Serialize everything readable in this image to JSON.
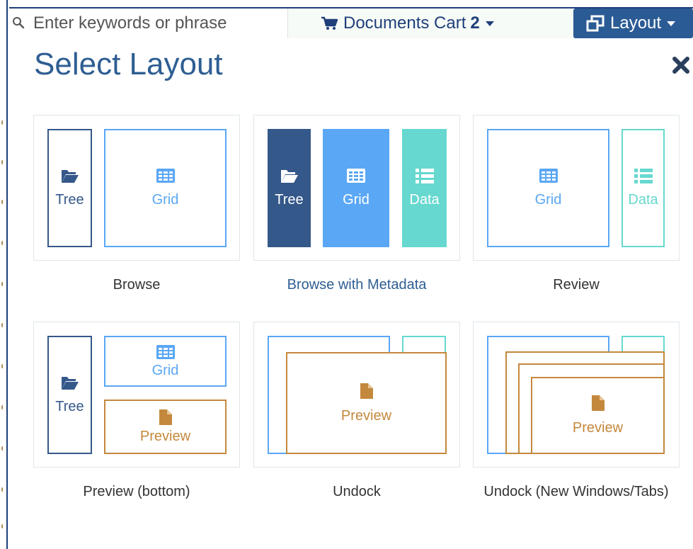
{
  "search": {
    "placeholder": "Enter keywords or phrase"
  },
  "cart": {
    "label": "Documents Cart",
    "count": "2"
  },
  "layout_button": {
    "label": "Layout"
  },
  "dialog": {
    "title": "Select Layout"
  },
  "pane_labels": {
    "tree": "Tree",
    "grid": "Grid",
    "data": "Data",
    "preview": "Preview"
  },
  "layouts": [
    {
      "caption": "Browse"
    },
    {
      "caption": "Browse with Metadata",
      "selected": true
    },
    {
      "caption": "Review"
    },
    {
      "caption": "Preview (bottom)"
    },
    {
      "caption": "Undock"
    },
    {
      "caption": "Undock (New Windows/Tabs)"
    }
  ],
  "colors": {
    "primary": "#2e5e92",
    "tree": "#35588a",
    "grid": "#5aa7f5",
    "data": "#66d8cf",
    "preview": "#c4883c"
  },
  "icons": [
    "search-icon",
    "cart-icon",
    "layout-icon",
    "close-icon",
    "folder-icon",
    "grid-icon",
    "list-icon",
    "document-icon"
  ]
}
